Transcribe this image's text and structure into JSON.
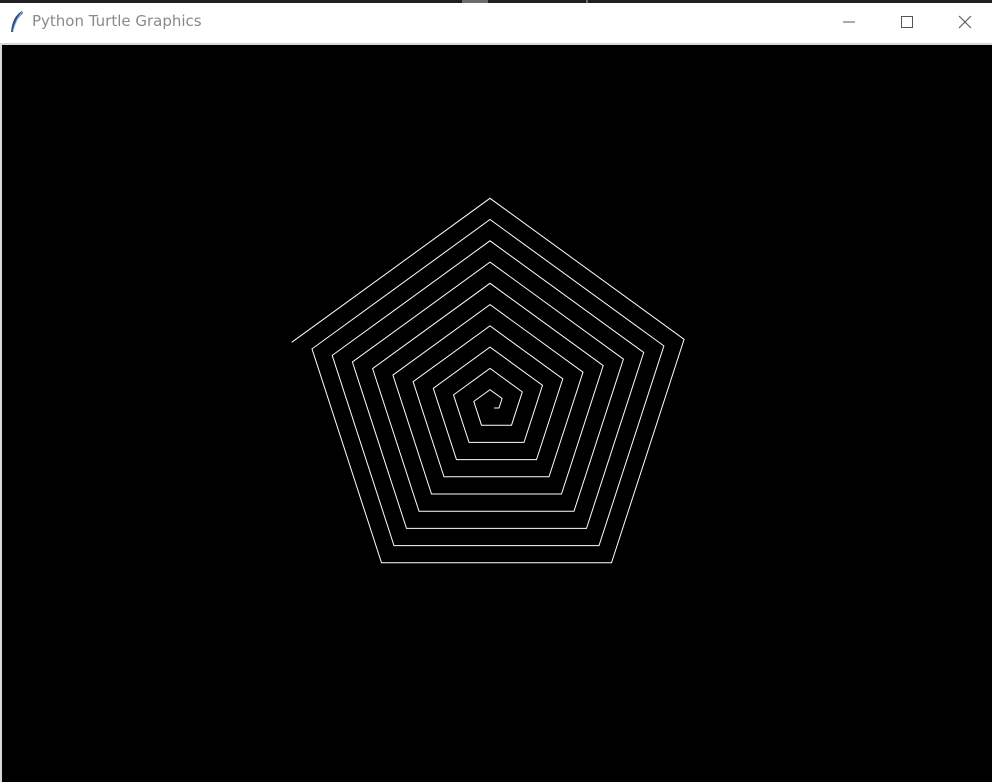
{
  "window": {
    "title": "Python Turtle Graphics",
    "icons": {
      "app": "feather-icon",
      "minimize": "minimize-icon",
      "maximize": "maximize-icon",
      "close": "close-icon"
    }
  },
  "canvas": {
    "background": "#000000",
    "pen_color": "#ffffff",
    "drawing": "pentagon-spiral"
  }
}
